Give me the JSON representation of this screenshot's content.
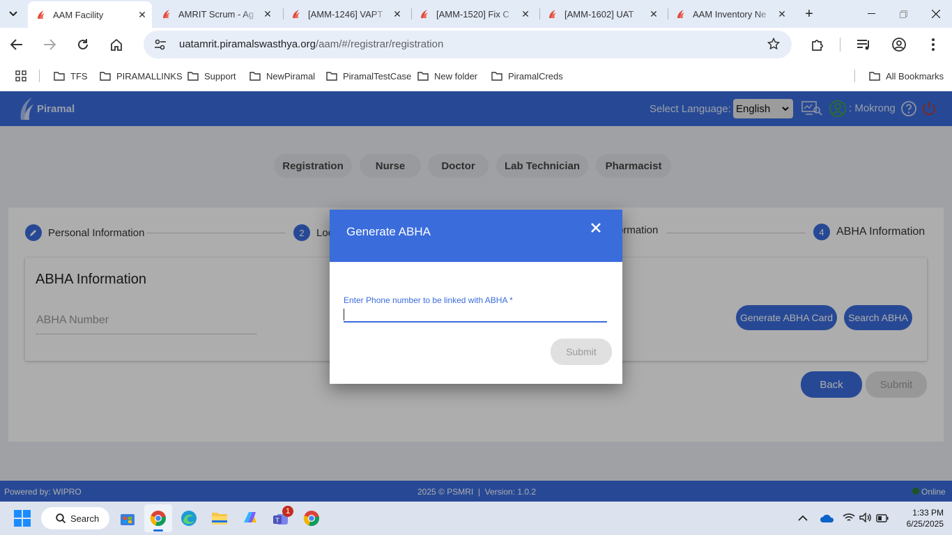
{
  "browser": {
    "tabs": [
      {
        "title": "AAM Facility",
        "active": true
      },
      {
        "title": "AMRIT Scrum - Ag",
        "active": false
      },
      {
        "title": "[AMM-1246] VAPT",
        "active": false
      },
      {
        "title": "[AMM-1520] Fix C",
        "active": false
      },
      {
        "title": "[AMM-1602] UAT",
        "active": false
      },
      {
        "title": "AAM Inventory Ne",
        "active": false
      }
    ],
    "url_host": "uatamrit.piramalswasthya.org",
    "url_path": "/aam/#/registrar/registration",
    "bookmarks": [
      "TFS",
      "PIRAMALLINKS",
      "Support",
      "NewPiramal",
      "PiramalTestCase",
      "New folder",
      "PiramalCreds"
    ],
    "all_bookmarks": "All Bookmarks"
  },
  "app": {
    "brand": "Piramal",
    "select_language_label": "Select Language:",
    "language": "English",
    "user": ": Mokrong",
    "roles": [
      "Registration",
      "Nurse",
      "Doctor",
      "Lab Technician",
      "Pharmacist"
    ],
    "steps": {
      "s1": "Personal Information",
      "s2_num": "2",
      "s2": "Loc",
      "s3": "ormation",
      "s4_num": "4",
      "s4": "ABHA Information"
    },
    "section_title": "ABHA Information",
    "abha_placeholder": "ABHA Number",
    "generate_btn": "Generate ABHA Card",
    "search_btn": "Search ABHA",
    "back_btn": "Back",
    "submit_btn": "Submit",
    "footer_left": "Powered by: WIPRO",
    "footer_center": "2025 © PSMRI  |  Version: 1.0.2",
    "footer_status": "Online"
  },
  "dialog": {
    "title": "Generate ABHA",
    "field_label": "Enter Phone number to be linked with ABHA *",
    "submit": "Submit"
  },
  "taskbar": {
    "search": "Search",
    "time": "1:33 PM",
    "date": "6/25/2025",
    "teams_badge": "1"
  },
  "colors": {
    "accent": "#3a6cdc",
    "online": "#2e7d32"
  }
}
